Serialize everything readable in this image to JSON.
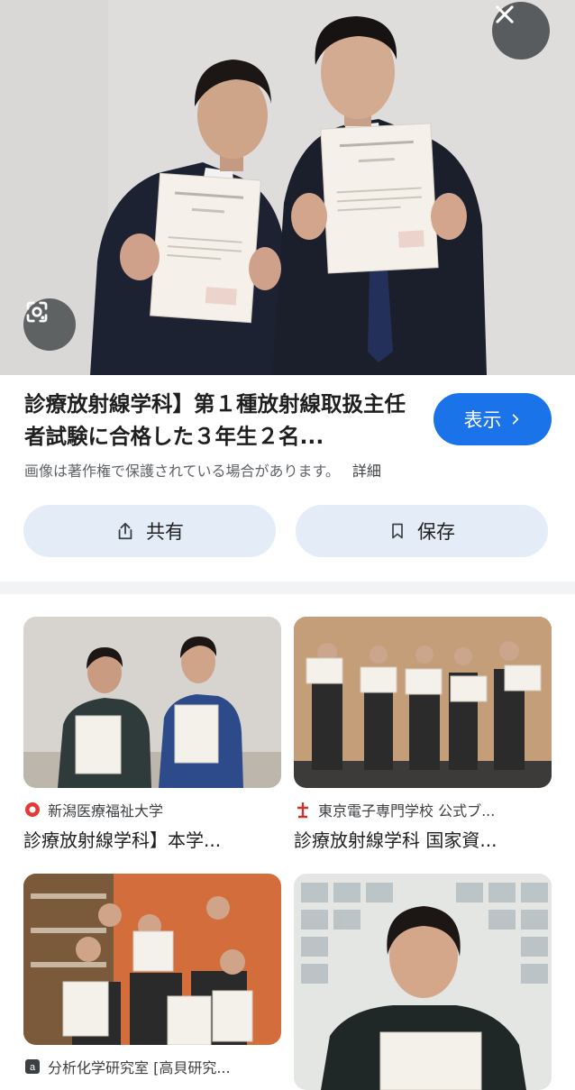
{
  "controls": {
    "close_icon": "close-icon",
    "lens_icon": "google-lens-icon"
  },
  "result": {
    "title": "診療放射線学科】第１種放射線取扱主任者試験に合格した３年生２名...",
    "visit_label": "表示",
    "visit_icon": "chevron-right-icon",
    "copyright_notice": "画像は著作権で保護されている場合があります。",
    "details_label": "詳細",
    "share_label": "共有",
    "save_label": "保存"
  },
  "colors": {
    "accent": "#1a73e8",
    "action_bg": "#e4ecf8",
    "muted_text": "#5f6368"
  },
  "related": [
    {
      "source": "新潟医療福祉大学",
      "title": "診療放射線学科】本学...",
      "source_icon": "university-logo-icon"
    },
    {
      "source": "東京電子専門学校 公式ブ...",
      "title": "診療放射線学科 国家資...",
      "source_icon": "school-logo-icon"
    },
    {
      "source": "分析化学研究室 [高貝研究...",
      "title": "",
      "source_icon": "lab-logo-icon"
    },
    {
      "source": "",
      "title": "",
      "source_icon": ""
    }
  ]
}
